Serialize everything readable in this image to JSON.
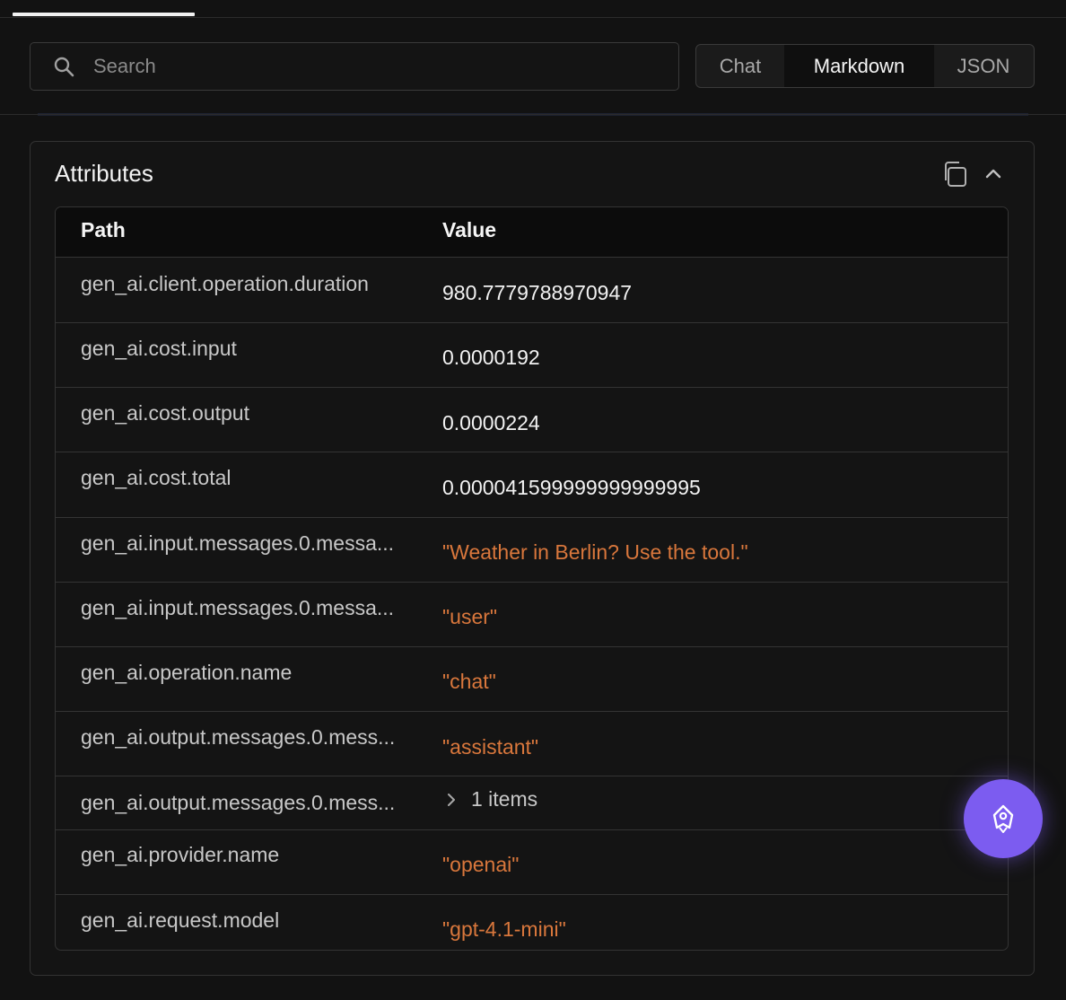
{
  "search": {
    "placeholder": "Search",
    "value": ""
  },
  "view_toggle": {
    "options": [
      "Chat",
      "Markdown",
      "JSON"
    ],
    "selected": "Markdown"
  },
  "attributes": {
    "title": "Attributes",
    "columns": {
      "path": "Path",
      "value": "Value"
    },
    "rows": [
      {
        "path": "gen_ai.client.operation.duration",
        "value": "980.7779788970947",
        "kind": "number"
      },
      {
        "path": "gen_ai.cost.input",
        "value": "0.0000192",
        "kind": "number"
      },
      {
        "path": "gen_ai.cost.output",
        "value": "0.0000224",
        "kind": "number"
      },
      {
        "path": "gen_ai.cost.total",
        "value": "0.000041599999999999995",
        "kind": "number"
      },
      {
        "path": "gen_ai.input.messages.0.messa...",
        "value": "\"Weather in Berlin? Use the tool.\"",
        "kind": "string"
      },
      {
        "path": "gen_ai.input.messages.0.messa...",
        "value": "\"user\"",
        "kind": "string"
      },
      {
        "path": "gen_ai.operation.name",
        "value": "\"chat\"",
        "kind": "string"
      },
      {
        "path": "gen_ai.output.messages.0.mess...",
        "value": "\"assistant\"",
        "kind": "string"
      },
      {
        "path": "gen_ai.output.messages.0.mess...",
        "value": "1 items",
        "kind": "collapsed"
      },
      {
        "path": "gen_ai.provider.name",
        "value": "\"openai\"",
        "kind": "string"
      },
      {
        "path": "gen_ai.request.model",
        "value": "\"gpt-4.1-mini\"",
        "kind": "string"
      }
    ]
  },
  "icons": {
    "search": "search-icon",
    "copy": "copy-icon",
    "collapse": "chevron-up-icon",
    "expand_row": "chevron-right-icon",
    "fab": "assistant-icon"
  },
  "colors": {
    "background": "#121212",
    "string_value": "#d9773c",
    "fab": "#7c5cf0"
  }
}
